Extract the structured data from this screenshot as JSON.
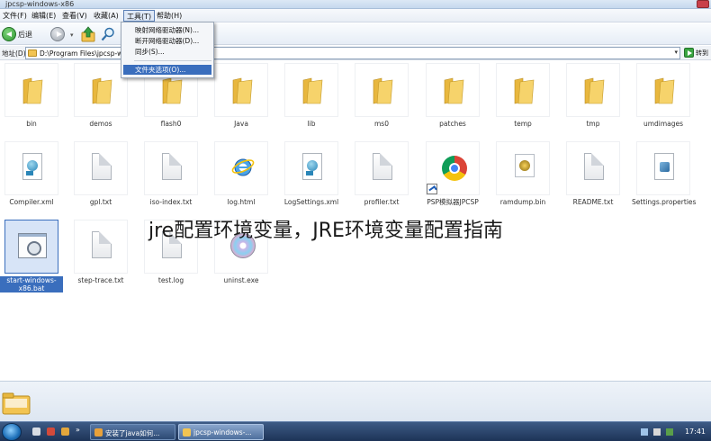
{
  "window": {
    "title": "jpcsp-windows-x86"
  },
  "menubar": {
    "items": [
      {
        "label": "文件(F)",
        "active": false
      },
      {
        "label": "编辑(E)",
        "active": false
      },
      {
        "label": "查看(V)",
        "active": false
      },
      {
        "label": "收藏(A)",
        "active": false
      },
      {
        "label": "工具(T)",
        "active": true
      },
      {
        "label": "帮助(H)",
        "active": false
      }
    ]
  },
  "tools_menu": {
    "items": [
      {
        "label": "映射网络驱动器(N)...",
        "highlighted": false
      },
      {
        "label": "断开网络驱动器(D)...",
        "highlighted": false
      },
      {
        "label": "同步(S)...",
        "highlighted": false
      },
      {
        "label": "文件夹选项(O)...",
        "highlighted": true
      }
    ]
  },
  "toolbar": {
    "back_label": "后退",
    "forward_dropdown": "▾"
  },
  "addressbar": {
    "label": "地址(D)",
    "value": "D:\\Program Files\\jpcsp-wi",
    "go_label": "转到"
  },
  "files": [
    {
      "name": "bin",
      "kind": "folder"
    },
    {
      "name": "demos",
      "kind": "folder"
    },
    {
      "name": "flash0",
      "kind": "folder"
    },
    {
      "name": "Java",
      "kind": "folder"
    },
    {
      "name": "lib",
      "kind": "folder"
    },
    {
      "name": "ms0",
      "kind": "folder"
    },
    {
      "name": "patches",
      "kind": "folder"
    },
    {
      "name": "temp",
      "kind": "folder"
    },
    {
      "name": "tmp",
      "kind": "folder"
    },
    {
      "name": "umdimages",
      "kind": "folder"
    },
    {
      "name": "Compiler.xml",
      "kind": "xml"
    },
    {
      "name": "gpl.txt",
      "kind": "txt"
    },
    {
      "name": "iso-index.txt",
      "kind": "txt"
    },
    {
      "name": "log.html",
      "kind": "html"
    },
    {
      "name": "LogSettings.xml",
      "kind": "xml"
    },
    {
      "name": "profiler.txt",
      "kind": "txt"
    },
    {
      "name": "PSP模拟器JPCSP",
      "kind": "shortcut"
    },
    {
      "name": "ramdump.bin",
      "kind": "bin"
    },
    {
      "name": "README.txt",
      "kind": "txt"
    },
    {
      "name": "Settings.properties",
      "kind": "props"
    },
    {
      "name": "start-windows-x86.bat",
      "kind": "bat",
      "selected": true
    },
    {
      "name": "step-trace.txt",
      "kind": "txt"
    },
    {
      "name": "test.log",
      "kind": "txt"
    },
    {
      "name": "uninst.exe",
      "kind": "exe"
    }
  ],
  "overlay": {
    "text": "jre配置环境变量，JRE环境变量配置指南"
  },
  "taskbar": {
    "buttons": [
      {
        "label": "安装了java如何...",
        "active": false
      },
      {
        "label": "jpcsp-windows-...",
        "active": true
      }
    ],
    "clock": "17:41"
  },
  "colors": {
    "selection": "#3a6ebd",
    "folder": "#f2c452",
    "taskbar": "#1d3357"
  }
}
